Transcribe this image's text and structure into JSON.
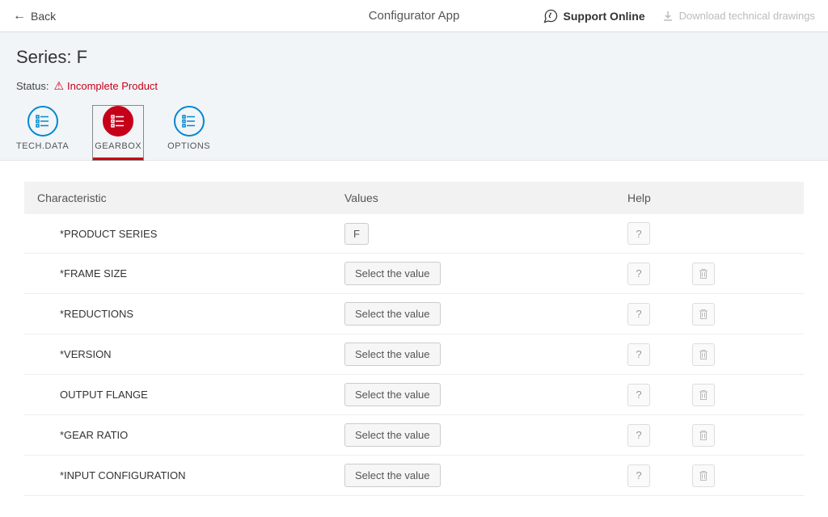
{
  "top_bar": {
    "back_label": "Back",
    "app_title": "Configurator App",
    "support_label": "Support Online",
    "download_label": "Download technical drawings"
  },
  "header": {
    "series_title": "Series: F",
    "status_label": "Status:",
    "status_value": "Incomplete Product"
  },
  "tabs": [
    {
      "label": "TECH.DATA",
      "active": false
    },
    {
      "label": "GEARBOX",
      "active": true
    },
    {
      "label": "OPTIONS",
      "active": false
    }
  ],
  "table": {
    "header_characteristic": "Characteristic",
    "header_values": "Values",
    "header_help": "Help",
    "rows": [
      {
        "name": "*PRODUCT SERIES",
        "value": "F",
        "help": true,
        "del": false
      },
      {
        "name": "*FRAME SIZE",
        "value": "Select the value",
        "help": true,
        "del": true
      },
      {
        "name": "*REDUCTIONS",
        "value": "Select the value",
        "help": true,
        "del": true
      },
      {
        "name": "*VERSION",
        "value": "Select the value",
        "help": true,
        "del": true
      },
      {
        "name": "OUTPUT FLANGE",
        "value": "Select the value",
        "help": true,
        "del": true
      },
      {
        "name": "*GEAR RATIO",
        "value": "Select the value",
        "help": true,
        "del": true
      },
      {
        "name": "*INPUT CONFIGURATION",
        "value": "Select the value",
        "help": true,
        "del": true
      }
    ]
  },
  "buttons": {
    "help_symbol": "?",
    "select_placeholder": "Select the value"
  }
}
